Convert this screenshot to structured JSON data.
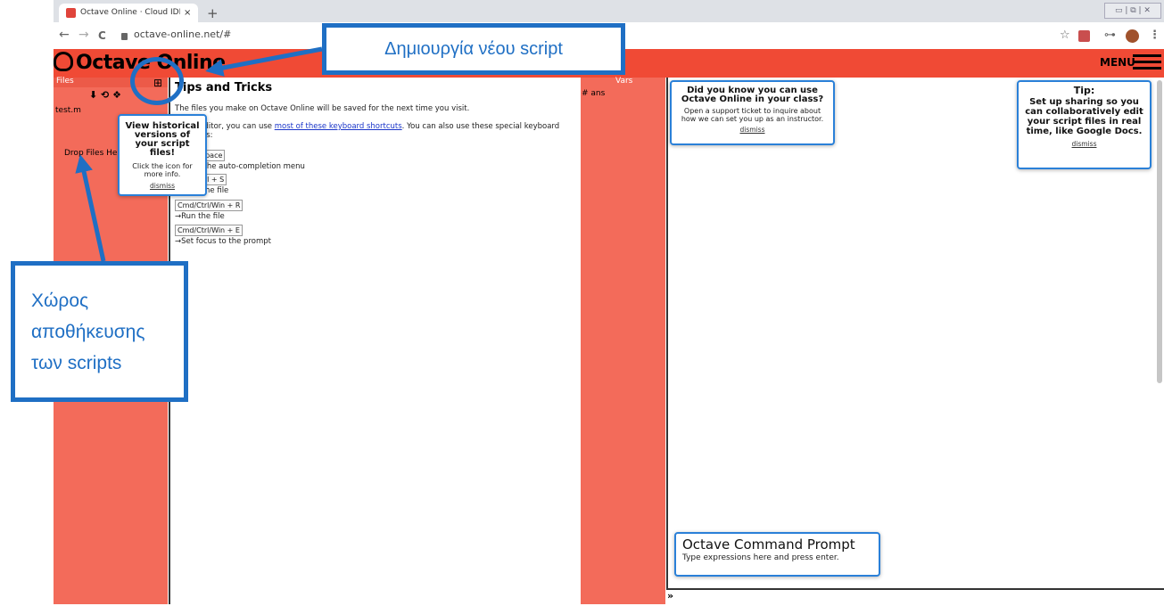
{
  "browser": {
    "tab_title": "Octave Online · Cloud IDE compatib",
    "tab_close": "×",
    "new_tab": "+",
    "back": "←",
    "forward": "→",
    "reload": "C",
    "url": "octave-online.net/#",
    "star": "☆",
    "key": "⊶",
    "more": "⋮",
    "window_controls": "▭ | ⧉ | ✕"
  },
  "app": {
    "logo": "Octave Online",
    "menu_label": "MENU"
  },
  "files_panel": {
    "title": "Files",
    "actions": "⬇ ⟲ ❖",
    "new_file_icon": "⊞",
    "items": [
      "test.m"
    ],
    "drop_text": "Drop Files Here"
  },
  "editor": {
    "tips_title": "Tips and Tricks",
    "line1": "The files you make on Octave Online will be saved for the next time you visit.",
    "line2_pre": "In the editor, you can use ",
    "line2_link": "most of these keyboard shortcuts",
    "line2_post": ". You can also use these special keyboard",
    "line2_cont": "shortcuts:",
    "shortcuts": [
      {
        "keys": "Ctrl + Space",
        "desc": "→Open the auto-completion menu"
      },
      {
        "keys": "Cmd/Ctrl + S",
        "desc": "→Save the file"
      },
      {
        "keys": "Cmd/Ctrl/Win + R",
        "desc": "→Run the file"
      },
      {
        "keys": "Cmd/Ctrl/Win + E",
        "desc": "→Set focus to the prompt"
      }
    ]
  },
  "vars_panel": {
    "title": "Vars",
    "items": [
      "# ans"
    ]
  },
  "popups": {
    "history": {
      "heading": "View historical versions of your script files!",
      "text": "Click the icon for more info.",
      "dismiss": "dismiss"
    },
    "classroom": {
      "heading": "Did you know you can use Octave Online in your class?",
      "text": "Open a support ticket to inquire about how we can set you up as an instructor.",
      "dismiss": "dismiss"
    },
    "sharing": {
      "heading": "Tip:",
      "text_pre": "Set up ",
      "text_bold": "sharing",
      "text_post": " so you can collaboratively edit your script files in real time, like Google Docs.",
      "dismiss": "dismiss"
    },
    "command": {
      "heading": "Octave Command Prompt",
      "text": "Type expressions here and press enter."
    }
  },
  "console": {
    "prompt_symbol": "»",
    "input_value": ""
  },
  "annotations": {
    "new_script": "Δημιουργία νέου script",
    "storage_line1": "Χώρος",
    "storage_line2": "αποθήκευσης",
    "storage_line3": "των scripts"
  },
  "colors": {
    "header_red": "#f04a35",
    "panel_red": "#f36b5a",
    "annotation_blue": "#1f6fc4",
    "popup_border": "#2a80d8"
  }
}
